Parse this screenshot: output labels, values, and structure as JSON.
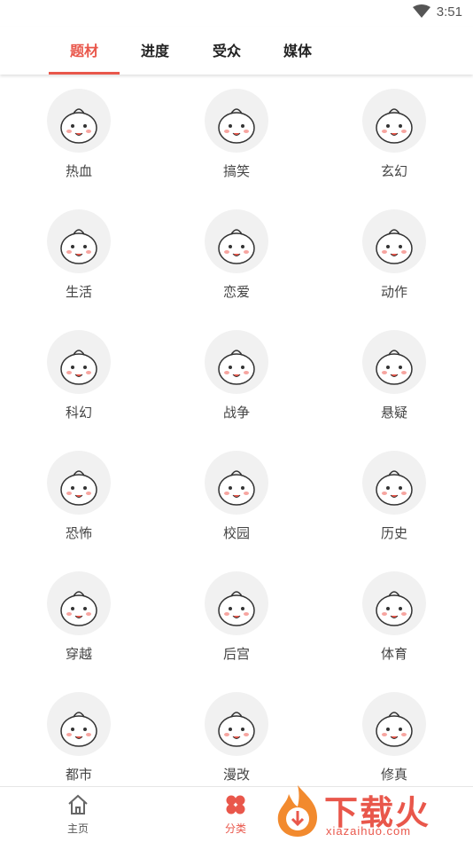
{
  "status_bar": {
    "time": "3:51"
  },
  "tabs": [
    {
      "label": "题材",
      "active": true
    },
    {
      "label": "进度",
      "active": false
    },
    {
      "label": "受众",
      "active": false
    },
    {
      "label": "媒体",
      "active": false
    }
  ],
  "categories": [
    {
      "label": "热血",
      "icon": "fire-bun-icon"
    },
    {
      "label": "搞笑",
      "icon": "laughing-bun-icon"
    },
    {
      "label": "玄幻",
      "icon": "magic-bun-icon"
    },
    {
      "label": "生活",
      "icon": "daily-life-bun-icon"
    },
    {
      "label": "恋爱",
      "icon": "love-bun-icon"
    },
    {
      "label": "动作",
      "icon": "action-bun-icon"
    },
    {
      "label": "科幻",
      "icon": "ufo-bun-icon"
    },
    {
      "label": "战争",
      "icon": "war-bun-icon"
    },
    {
      "label": "悬疑",
      "icon": "mystery-bun-icon"
    },
    {
      "label": "恐怖",
      "icon": "horror-bun-icon"
    },
    {
      "label": "校园",
      "icon": "school-bun-icon"
    },
    {
      "label": "历史",
      "icon": "history-bun-icon"
    },
    {
      "label": "穿越",
      "icon": "time-travel-bun-icon"
    },
    {
      "label": "后宫",
      "icon": "palace-bun-icon"
    },
    {
      "label": "体育",
      "icon": "sports-bun-icon"
    },
    {
      "label": "都市",
      "icon": "city-bun-icon"
    },
    {
      "label": "漫改",
      "icon": "comic-adaptation-bun-icon"
    },
    {
      "label": "修真",
      "icon": "cultivation-bun-icon"
    }
  ],
  "bottom_nav": [
    {
      "label": "主页",
      "icon": "home-icon",
      "active": false
    },
    {
      "label": "分类",
      "icon": "category-grid-icon",
      "active": true
    }
  ],
  "watermark": {
    "text": "下载火",
    "url": "xiazaihuo.com"
  },
  "colors": {
    "accent": "#e9574b",
    "tab_text": "#222222",
    "label_text": "#444444"
  }
}
